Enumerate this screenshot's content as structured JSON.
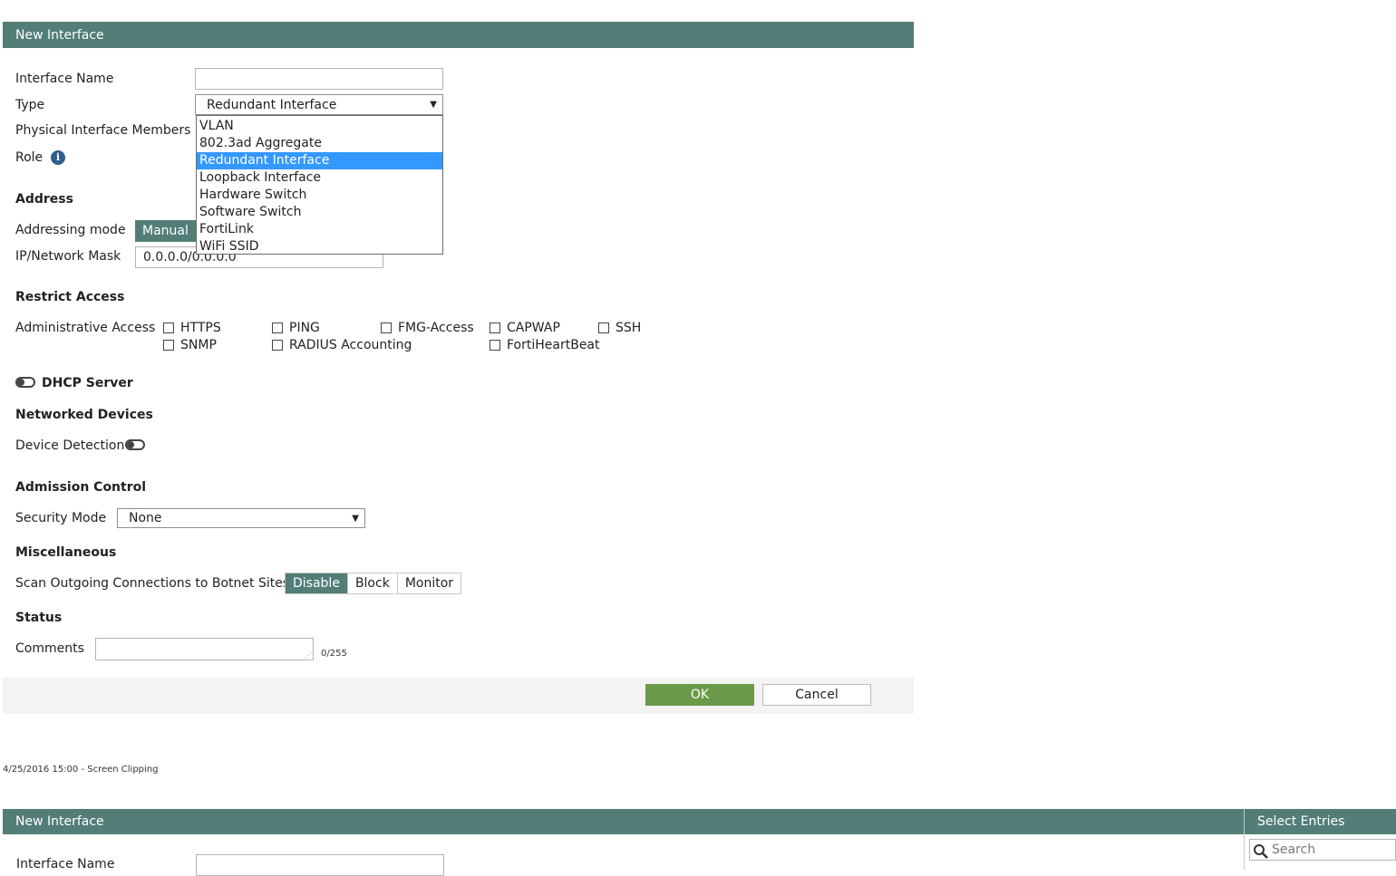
{
  "dialog": {
    "title": "New Interface",
    "fields": {
      "interface_name_label": "Interface Name",
      "interface_name_value": "",
      "type_label": "Type",
      "type_value": "Redundant Interface",
      "physical_members_label": "Physical Interface Members",
      "role_label": "Role"
    },
    "type_options": [
      "VLAN",
      "802.3ad Aggregate",
      "Redundant Interface",
      "Loopback Interface",
      "Hardware Switch",
      "Software Switch",
      "FortiLink",
      "WiFi SSID"
    ],
    "type_selected_index": 2,
    "address": {
      "section": "Address",
      "mode_label": "Addressing mode",
      "mode_button": "Manual",
      "ip_label": "IP/Network Mask",
      "ip_value": "0.0.0.0/0.0.0.0"
    },
    "restrict": {
      "section": "Restrict Access",
      "admin_label": "Administrative Access",
      "options": [
        "HTTPS",
        "PING",
        "FMG-Access",
        "CAPWAP",
        "SSH",
        "SNMP",
        "RADIUS Accounting",
        "FortiHeartBeat"
      ]
    },
    "dhcp_label": "DHCP Server",
    "networked": {
      "section": "Networked Devices",
      "detection_label": "Device Detection"
    },
    "admission": {
      "section": "Admission Control",
      "security_label": "Security Mode",
      "security_value": "None"
    },
    "misc": {
      "section": "Miscellaneous",
      "botnet_label": "Scan Outgoing Connections to Botnet Sites",
      "options": [
        "Disable",
        "Block",
        "Monitor"
      ],
      "active": "Disable"
    },
    "status_section": "Status",
    "comments_label": "Comments",
    "comments_counter": "0/255",
    "ok_label": "OK",
    "cancel_label": "Cancel"
  },
  "clipping_caption": "4/25/2016 15:00 - Screen Clipping",
  "second": {
    "title": "New Interface",
    "interface_name_label": "Interface Name",
    "select_entries_title": "Select Entries",
    "search_placeholder": "Search"
  },
  "colors": {
    "header": "#527e77",
    "ok_button": "#6a9a4a",
    "highlight": "#3399ff"
  }
}
